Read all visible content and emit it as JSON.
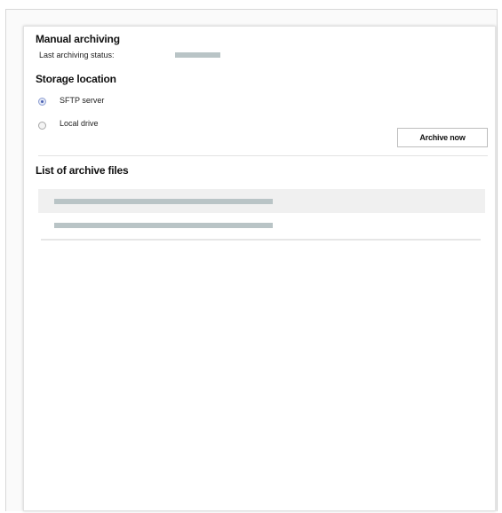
{
  "manual_archiving": {
    "title": "Manual archiving",
    "status_label": "Last archiving status:"
  },
  "storage_location": {
    "title": "Storage location",
    "options": [
      {
        "label": "SFTP server",
        "selected": true
      },
      {
        "label": "Local drive",
        "selected": false
      }
    ],
    "archive_button_label": "Archive now"
  },
  "archive_files": {
    "title": "List of archive files"
  },
  "colors": {
    "placeholder": "#b9c4c6",
    "row_shade": "#f0f0f0",
    "radio_selected": "#4a61b3"
  }
}
